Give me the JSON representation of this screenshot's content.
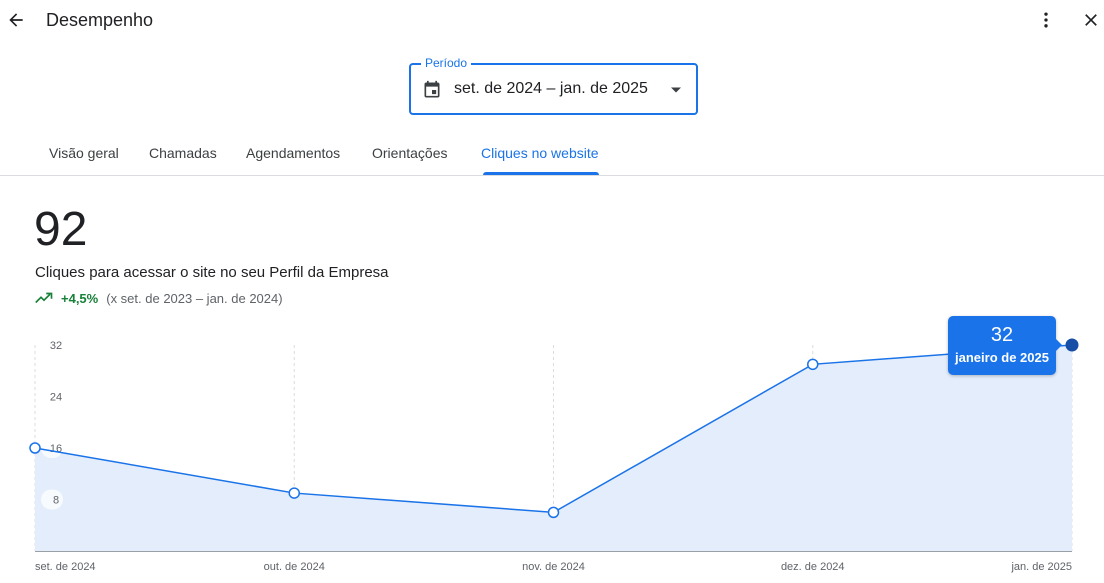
{
  "header": {
    "title": "Desempenho"
  },
  "period": {
    "label": "Período",
    "value": "set. de 2024 – jan. de 2025"
  },
  "tabs": [
    {
      "label": "Visão geral"
    },
    {
      "label": "Chamadas"
    },
    {
      "label": "Agendamentos"
    },
    {
      "label": "Orientações"
    },
    {
      "label": "Cliques no website",
      "active": true
    }
  ],
  "metric": {
    "value": "92",
    "description": "Cliques para acessar o site no seu Perfil da Empresa",
    "change": "+4,5%",
    "comparison": "(x set. de 2023 – jan. de 2024)"
  },
  "tooltip": {
    "value": "32",
    "label": "janeiro de 2025"
  },
  "colors": {
    "accent": "#1a73e8",
    "positive": "#188038",
    "area_fill": "#e3edfc"
  },
  "chart_data": {
    "type": "area",
    "categories": [
      "set. de 2024",
      "out. de 2024",
      "nov. de 2024",
      "dez. de 2024",
      "jan. de 2025"
    ],
    "series": [
      {
        "values": [
          16,
          9,
          6,
          29,
          32
        ]
      }
    ],
    "yticks": [
      8,
      16,
      24,
      32
    ],
    "ylim": [
      0,
      32
    ],
    "grid": "vertical-dashed",
    "highlighted_index": 4
  }
}
